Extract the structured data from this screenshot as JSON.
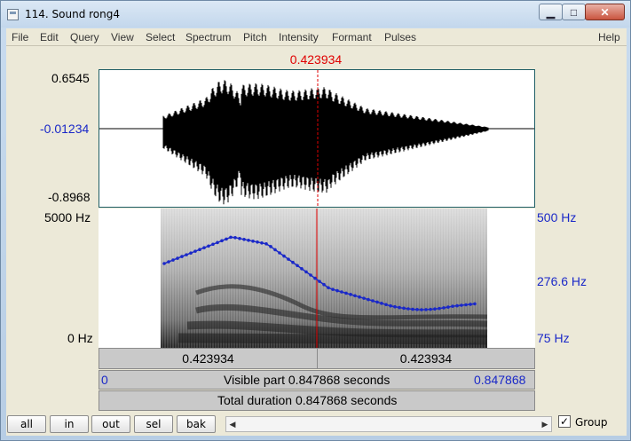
{
  "window": {
    "title": "114. Sound rong4",
    "minimize_glyph": "▁",
    "maximize_glyph": "□",
    "close_glyph": "✕"
  },
  "menu": [
    "File",
    "Edit",
    "Query",
    "View",
    "Select",
    "Spectrum",
    "Pitch",
    "Intensity",
    "Formant",
    "Pulses",
    "Help"
  ],
  "cursor": {
    "time": "0.423934"
  },
  "waveform": {
    "y_top": "0.6545",
    "y_cursor": "-0.01234",
    "y_bottom": "-0.8968"
  },
  "spectrogram": {
    "freq_top": "5000 Hz",
    "freq_bottom": "0 Hz",
    "pitch_top": "500 Hz",
    "pitch_cursor": "276.6 Hz",
    "pitch_bottom": "75 Hz"
  },
  "time_bar": {
    "left_value": "0.423934",
    "right_value": "0.423934",
    "visible_start": "0",
    "visible_text": "Visible part 0.847868 seconds",
    "visible_end": "0.847868",
    "total_text": "Total duration 0.847868 seconds"
  },
  "buttons": {
    "all": "all",
    "in": "in",
    "out": "out",
    "sel": "sel",
    "bak": "bak"
  },
  "group": {
    "label": "Group",
    "checked": true,
    "check_glyph": "✓"
  },
  "colors": {
    "cursor": "#e00000",
    "pitch_track": "#1a28c8",
    "axis_blue": "#1a28c8"
  },
  "icons": {
    "scroll_left": "◀",
    "scroll_right": "▶"
  }
}
